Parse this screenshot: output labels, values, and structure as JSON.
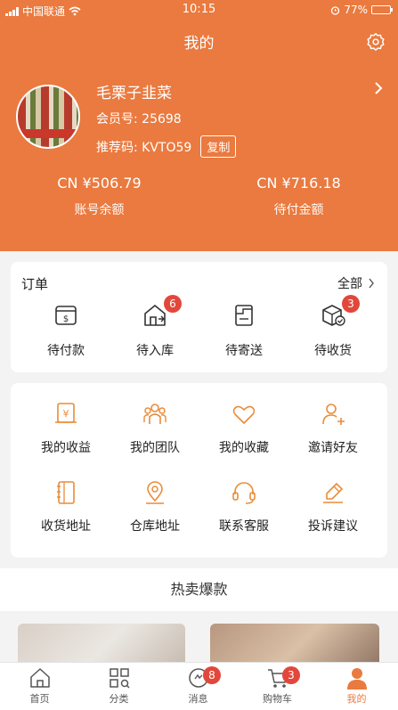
{
  "status_bar": {
    "carrier": "中国联通",
    "time": "10:15",
    "battery": "77%",
    "battery_level": 0.77
  },
  "page": {
    "title": "我的"
  },
  "profile": {
    "nickname": "毛栗子韭菜",
    "member_no": "会员号: 25698",
    "referral": "推荐码: KVTO59",
    "copy_label": "复制"
  },
  "balances": [
    {
      "amount": "CN ¥506.79",
      "label": "账号余额"
    },
    {
      "amount": "CN ¥716.18",
      "label": "待付金额"
    }
  ],
  "orders": {
    "title": "订单",
    "all_label": "全部",
    "items": [
      {
        "label": "待付款",
        "icon": "payment-icon"
      },
      {
        "label": "待入库",
        "icon": "warehouse-in-icon",
        "badge": "6"
      },
      {
        "label": "待寄送",
        "icon": "shipping-box-icon"
      },
      {
        "label": "待收货",
        "icon": "receive-box-icon",
        "badge": "3"
      }
    ]
  },
  "services": [
    {
      "label": "我的收益",
      "icon": "earnings-icon"
    },
    {
      "label": "我的团队",
      "icon": "team-icon"
    },
    {
      "label": "我的收藏",
      "icon": "heart-icon"
    },
    {
      "label": "邀请好友",
      "icon": "add-user-icon"
    },
    {
      "label": "收货地址",
      "icon": "address-book-icon"
    },
    {
      "label": "仓库地址",
      "icon": "location-pin-icon"
    },
    {
      "label": "联系客服",
      "icon": "headset-icon"
    },
    {
      "label": "投诉建议",
      "icon": "feedback-icon"
    }
  ],
  "hot_section": {
    "title": "热卖爆款"
  },
  "tabbar": {
    "items": [
      {
        "label": "首页",
        "icon": "home-icon"
      },
      {
        "label": "分类",
        "icon": "category-icon"
      },
      {
        "label": "消息",
        "icon": "message-icon",
        "badge": "8"
      },
      {
        "label": "购物车",
        "icon": "cart-icon",
        "badge": "3"
      },
      {
        "label": "我的",
        "icon": "profile-icon",
        "active": true
      }
    ]
  },
  "colors": {
    "accent": "#ea7a3f",
    "badge": "#e2473b",
    "icon_orange": "#e98c3a"
  }
}
